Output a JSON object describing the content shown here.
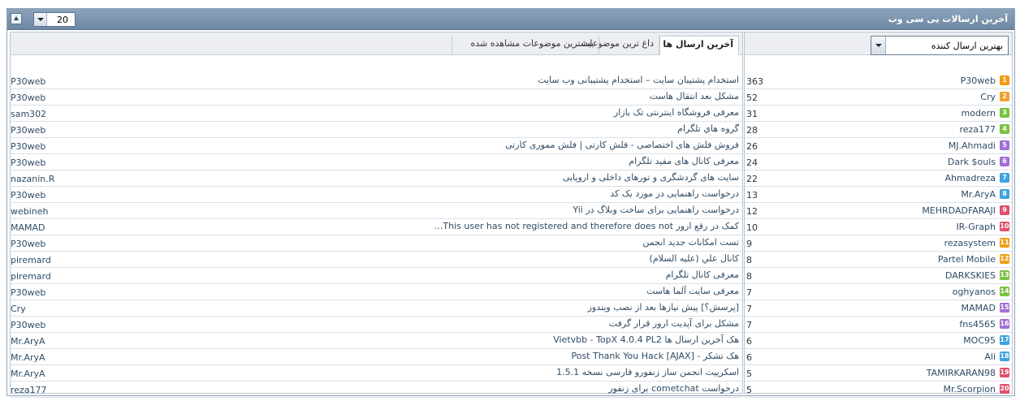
{
  "header": {
    "title": "آخرین ارسالات پی سی وب",
    "count_value": "20"
  },
  "tabs": [
    {
      "label": "آخرین ارسال ها",
      "active": true
    },
    {
      "label": "داغ ترین موضوعات",
      "active": false
    },
    {
      "label": "بیشترین موضوعات مشاهده شده",
      "active": false
    }
  ],
  "sort": {
    "selected": "بهترین ارسال کننده"
  },
  "posts": [
    {
      "topic": "استخدام پشتیبان سایت – استخدام پشتیبانی وب سایت",
      "user": "P30web"
    },
    {
      "topic": "مشکل بعد انتقال هاست",
      "user": "P30web"
    },
    {
      "topic": "معرفی فروشگاه اینترنتی تک بازار",
      "user": "sam302"
    },
    {
      "topic": "گروه هاي تلگرام",
      "user": "P30web"
    },
    {
      "topic": "فروش فلش های اختصاصی - فلش کارتی | فلش مموری کارتی",
      "user": "P30web"
    },
    {
      "topic": "معرفی کانال های مفید تلگرام",
      "user": "P30web"
    },
    {
      "topic": "سایت های گردشگری و تورهای داخلی و اروپایی",
      "user": "nazanin.R"
    },
    {
      "topic": "درخواست راهنمایی در مورد یک کد",
      "user": "P30web"
    },
    {
      "topic": "درخواست راهنمایی برای ساخت وبلاگ در Yii",
      "user": "webineh"
    },
    {
      "topic": "کمک در رفع ارور This user has not registered and therefore does not...",
      "user": "MAMAD"
    },
    {
      "topic": "تست امکانات جدید انجمن",
      "user": "P30web"
    },
    {
      "topic": "کانال علي (عليه السلام)",
      "user": "piremard"
    },
    {
      "topic": "معرفی کانال تلگرام",
      "user": "piremard"
    },
    {
      "topic": "معرفی سایت آلما هاست",
      "user": "P30web"
    },
    {
      "topic": "[پرسش؟] پیش نیازها بعد از نصب ویندوز",
      "user": "Cry"
    },
    {
      "topic": "مشکل برای آپدیت ارور قرار گرفت",
      "user": "P30web"
    },
    {
      "topic": "هک آخرین ارسال ها Vietvbb - TopX 4.0.4 PL2",
      "user": "Mr.AryA"
    },
    {
      "topic": "هک تشکر - [AJAX] Post Thank You Hack",
      "user": "Mr.AryA"
    },
    {
      "topic": "اسکریپت انجمن ساز زنفورو فارسی نسخه 1.5.1",
      "user": "Mr.AryA"
    },
    {
      "topic": "درخواست cometchat برای زنفور",
      "user": "reza177"
    }
  ],
  "posters": [
    {
      "rank": "1",
      "name": "P30web",
      "count": "363",
      "color": "#f39c12"
    },
    {
      "rank": "2",
      "name": "Cry",
      "count": "52",
      "color": "#f0a030"
    },
    {
      "rank": "3",
      "name": "modern",
      "count": "31",
      "color": "#7cc242"
    },
    {
      "rank": "4",
      "name": "reza177",
      "count": "28",
      "color": "#7cc242"
    },
    {
      "rank": "5",
      "name": "MJ.Ahmadi",
      "count": "26",
      "color": "#a36fd6"
    },
    {
      "rank": "6",
      "name": "Dark $ouls",
      "count": "24",
      "color": "#a36fd6"
    },
    {
      "rank": "7",
      "name": "Ahmadreza",
      "count": "22",
      "color": "#3ea2e0"
    },
    {
      "rank": "8",
      "name": "Mr.AryA",
      "count": "13",
      "color": "#3ea2e0"
    },
    {
      "rank": "9",
      "name": "MEHRDADFARAJI",
      "count": "12",
      "color": "#e0506a"
    },
    {
      "rank": "10",
      "name": "IR-Graph",
      "count": "10",
      "color": "#e0506a"
    },
    {
      "rank": "11",
      "name": "rezasystem",
      "count": "9",
      "color": "#f39c12"
    },
    {
      "rank": "12",
      "name": "Partel Mobile",
      "count": "8",
      "color": "#f39c12"
    },
    {
      "rank": "13",
      "name": "DARKSKIES",
      "count": "8",
      "color": "#7cc242"
    },
    {
      "rank": "14",
      "name": "oghyanos",
      "count": "7",
      "color": "#7cc242"
    },
    {
      "rank": "15",
      "name": "MAMAD",
      "count": "7",
      "color": "#a36fd6"
    },
    {
      "rank": "16",
      "name": "fns4565",
      "count": "7",
      "color": "#a36fd6"
    },
    {
      "rank": "17",
      "name": "MOC95",
      "count": "6",
      "color": "#3ea2e0"
    },
    {
      "rank": "18",
      "name": "Ali",
      "count": "6",
      "color": "#3ea2e0"
    },
    {
      "rank": "19",
      "name": "TAMIRKARAN98",
      "count": "5",
      "color": "#e0506a"
    },
    {
      "rank": "20",
      "name": "Mr.Scorpion",
      "count": "5",
      "color": "#e0506a"
    }
  ]
}
